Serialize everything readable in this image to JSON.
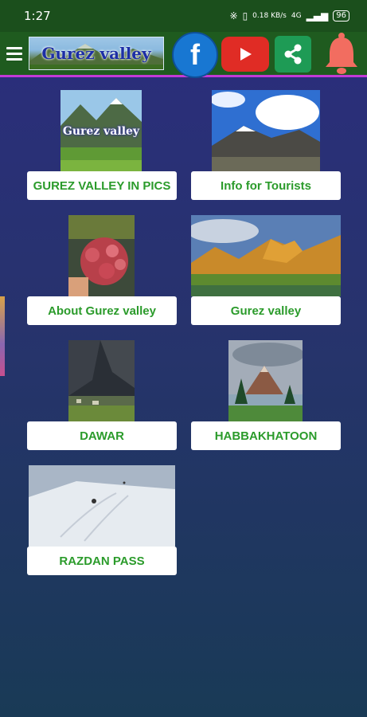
{
  "status_bar": {
    "time": "1:27",
    "network": "0.18 KB/s",
    "signal": "4G",
    "battery": "96"
  },
  "header": {
    "logo_text": "Gurez valley",
    "facebook_glyph": "f",
    "icons": [
      "menu-icon",
      "facebook-icon",
      "youtube-icon",
      "share-icon",
      "bell-icon"
    ]
  },
  "tiles": [
    {
      "label": "GUREZ VALLEY IN PICS",
      "thumb_text": "Gurez valley"
    },
    {
      "label": "Info for Tourists"
    },
    {
      "label": "About Gurez valley"
    },
    {
      "label": "Gurez valley"
    },
    {
      "label": "DAWAR"
    },
    {
      "label": "HABBAKHATOON"
    },
    {
      "label": "RAZDAN PASS"
    }
  ],
  "colors": {
    "header_green": "#1f5b1f",
    "accent_magenta": "#c23bd6",
    "label_green": "#2b9b2b",
    "background_blue": "#2b2d7e"
  }
}
